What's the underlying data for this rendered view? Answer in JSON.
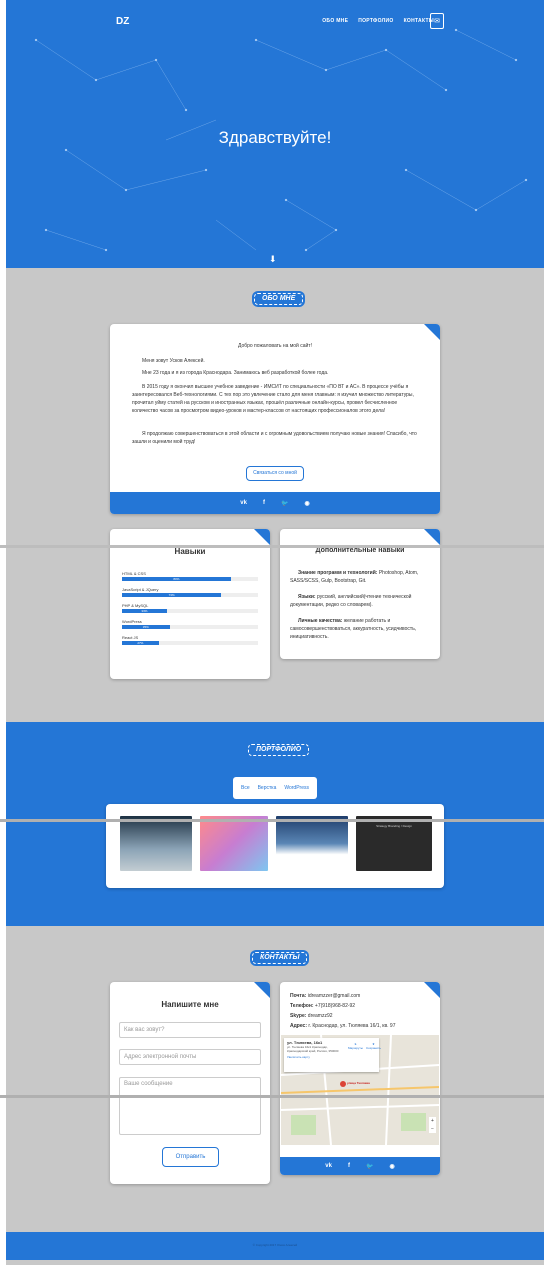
{
  "header": {
    "logo": "DZ",
    "nav": [
      "ОБО МНЕ",
      "ПОРТФОЛИО",
      "КОНТАКТЫ"
    ],
    "mail_icon": "envelope-icon"
  },
  "hero": {
    "title": "Здравствуйте!",
    "arrow_icon": "arrow-down-icon"
  },
  "about": {
    "badge": "ОБО МНЕ",
    "welcome": "Добро пожаловать на мой сайт!",
    "p1": "Меня зовут Усков Алексей.",
    "p2": "Мне 23 года и я из города Краснодара. Занимаюсь веб разработкой более года.",
    "p3": "В 2015 году я окончил высшее учебное заведение - ИМСИТ по специальности «ПО ВТ и АС». В процессе учёбы я заинтересовался Веб-технологиями. С тех пор это увлечение стало для меня главным: я изучил множество литературы, прочитал уйму статей на русском и иностранных языках, прошёл различные онлайн-курсы, провел бесчисленное количество часов за просмотром видео-уроков и мастер-классов от настоящих профессионалов этого дела!",
    "p4": "Я продолжаю совершенствоваться в этой области и с огромным удовольствием получаю новые знания! Спасибо, что зашли и оценили мой труд!",
    "contact_button": "Связаться со мной",
    "social": [
      "vk",
      "f",
      "twitter",
      "github"
    ]
  },
  "skills": {
    "title": "Навыки",
    "items": [
      {
        "label": "HTML & CSS",
        "percent": 80,
        "value_text": "80%"
      },
      {
        "label": "JavaScript & JQuery",
        "percent": 73,
        "value_text": "73%"
      },
      {
        "label": "PHP & MySQL",
        "percent": 33,
        "value_text": "33%"
      },
      {
        "label": "WordPress",
        "percent": 35,
        "value_text": "35%"
      },
      {
        "label": "React JS",
        "percent": 27,
        "value_text": "27%"
      }
    ]
  },
  "extra_skills": {
    "title": "Дополнительные навыки",
    "tech_label": "Знание программ и технологий:",
    "tech_text": "Photoshop, Atom, SASS/SCSS, Gulp, Bootstrap, Git.",
    "lang_label": "Языки:",
    "lang_text": "русский, английский(чтение технической документации, редко со словарем).",
    "qual_label": "Личные качества:",
    "qual_text": "желание работать и самосовершенствоваться, аккуратность, усидчивость, инициативность."
  },
  "portfolio": {
    "badge": "ПОРТФОЛИО",
    "filters": [
      "Все",
      "Верстка",
      "WordPress"
    ],
    "thumb_caption": "Strategy Branding / Design"
  },
  "contacts": {
    "badge": "КОНТАКТЫ",
    "form_title": "Напишите мне",
    "name_placeholder": "Как вас зовут?",
    "email_placeholder": "Адрес электронной почты",
    "message_placeholder": "Ваше сообщение",
    "submit": "Отправить",
    "mail_label": "Почта:",
    "mail_value": "idreamzzer@gmail.com",
    "phone_label": "Телефон:",
    "phone_value": "+7(918)968-82-92",
    "skype_label": "Skype:",
    "skype_value": "dreamzz92",
    "address_label": "Адрес:",
    "address_value": "г. Краснодар, ул. Тюляева 16/1, кв. 97",
    "map_popup_title": "ул. Тюляева, 16к1",
    "map_popup_addr": "ул. Тюляева 16к1 Краснодар, Краснодарский край, Россия, 350000",
    "map_enlarge": "Увеличить карту",
    "map_route": "Маршруты",
    "map_save": "Сохранить",
    "map_marker_label": "улица Тюляева"
  },
  "footer": {
    "text": "© Copyright 2017 Усков Алексей"
  }
}
